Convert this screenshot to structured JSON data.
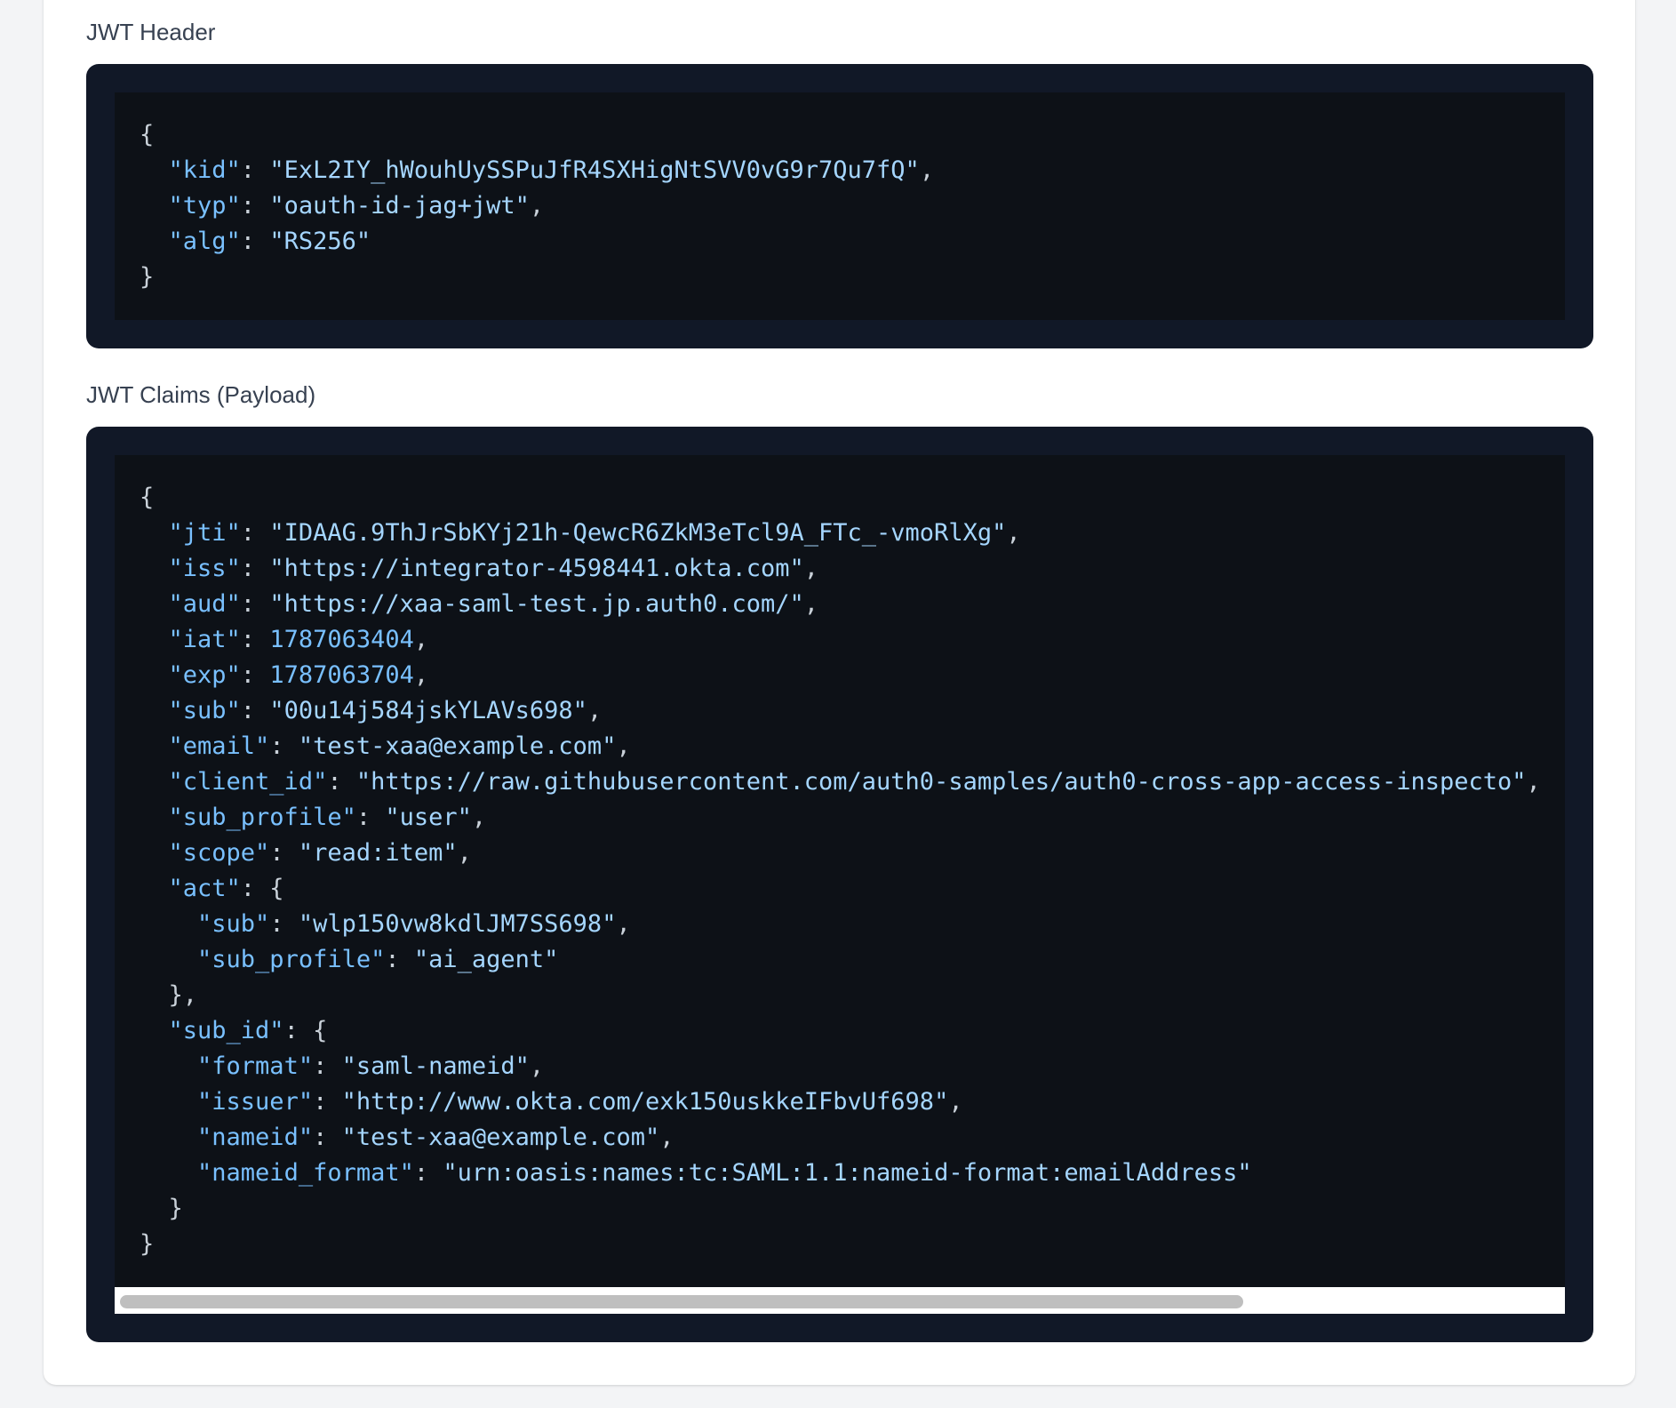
{
  "header_section": {
    "label": "JWT Header",
    "entries": [
      {
        "key": "kid",
        "value": "ExL2IY_hWouhUySSPuJfR4SXHigNtSVV0vG9r7Qu7fQ",
        "kind": "string"
      },
      {
        "key": "typ",
        "value": "oauth-id-jag+jwt",
        "kind": "string"
      },
      {
        "key": "alg",
        "value": "RS256",
        "kind": "string"
      }
    ]
  },
  "claims_section": {
    "label": "JWT Claims (Payload)",
    "entries": [
      {
        "key": "jti",
        "value": "IDAAG.9ThJrSbKYj21h-QewcR6ZkM3eTcl9A_FTc_-vmoRlXg",
        "kind": "string"
      },
      {
        "key": "iss",
        "value": "https://integrator-4598441.okta.com",
        "kind": "string"
      },
      {
        "key": "aud",
        "value": "https://xaa-saml-test.jp.auth0.com/",
        "kind": "string"
      },
      {
        "key": "iat",
        "value": 1787063404,
        "kind": "number"
      },
      {
        "key": "exp",
        "value": 1787063704,
        "kind": "number"
      },
      {
        "key": "sub",
        "value": "00u14j584jskYLAVs698",
        "kind": "string"
      },
      {
        "key": "email",
        "value": "test-xaa@example.com",
        "kind": "string"
      },
      {
        "key": "client_id",
        "value": "https://raw.githubusercontent.com/auth0-samples/auth0-cross-app-access-inspecto",
        "kind": "string"
      },
      {
        "key": "sub_profile",
        "value": "user",
        "kind": "string"
      },
      {
        "key": "scope",
        "value": "read:item",
        "kind": "string"
      },
      {
        "key": "act",
        "kind": "object",
        "entries": [
          {
            "key": "sub",
            "value": "wlp150vw8kdlJM7SS698",
            "kind": "string"
          },
          {
            "key": "sub_profile",
            "value": "ai_agent",
            "kind": "string"
          }
        ]
      },
      {
        "key": "sub_id",
        "kind": "object",
        "entries": [
          {
            "key": "format",
            "value": "saml-nameid",
            "kind": "string"
          },
          {
            "key": "issuer",
            "value": "http://www.okta.com/exk150uskkeIFbvUf698",
            "kind": "string"
          },
          {
            "key": "nameid",
            "value": "test-xaa@example.com",
            "kind": "string"
          },
          {
            "key": "nameid_format",
            "value": "urn:oasis:names:tc:SAML:1.1:nameid-format:emailAddress",
            "kind": "string"
          }
        ]
      }
    ]
  },
  "claims_scrollbar": {
    "visible_fraction": 0.78
  },
  "colors": {
    "frame": "#111827",
    "code_bg": "#0d1117",
    "key": "#79c0ff",
    "string": "#a5d6ff",
    "punctuation": "#c9d1d9"
  }
}
